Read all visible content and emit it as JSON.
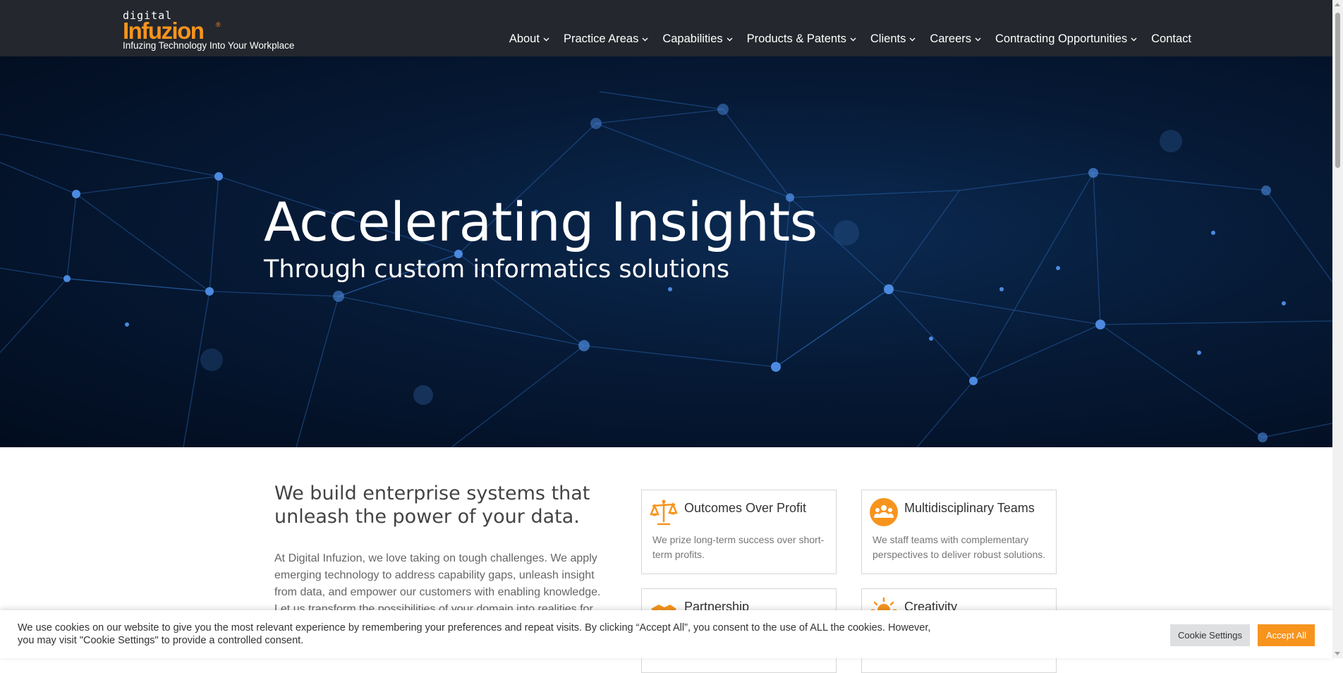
{
  "header": {
    "logo": {
      "small": "digital",
      "brand": "Infuzion",
      "reg": "®",
      "tagline": "Infuzing Technology Into Your Workplace"
    },
    "nav": [
      {
        "label": "About",
        "has_dropdown": true
      },
      {
        "label": "Practice Areas",
        "has_dropdown": true
      },
      {
        "label": "Capabilities",
        "has_dropdown": true
      },
      {
        "label": "Products & Patents",
        "has_dropdown": true
      },
      {
        "label": "Clients",
        "has_dropdown": true
      },
      {
        "label": "Careers",
        "has_dropdown": true
      },
      {
        "label": "Contracting Opportunities",
        "has_dropdown": true
      },
      {
        "label": "Contact",
        "has_dropdown": false
      }
    ]
  },
  "hero": {
    "title": "Accelerating Insights",
    "subtitle": "Through custom informatics solutions"
  },
  "intro": {
    "heading": "We build enterprise systems that unleash the power of your data.",
    "text": "At Digital Infuzion, we love taking on tough challenges. We apply emerging technology to address capability gaps, unleash insight from data, and empower our customers with enabling knowledge. Let us transform the possibilities of your domain into realities for"
  },
  "values": [
    {
      "title": "Outcomes Over Profit",
      "desc": "We prize long-term success over short-term profits.",
      "icon": "scale-icon"
    },
    {
      "title": "Multidisciplinary Teams",
      "desc": "We staff teams with complementary perspectives to deliver robust solutions.",
      "icon": "team-icon"
    },
    {
      "title": "Partnership",
      "desc": "",
      "icon": "handshake-icon"
    },
    {
      "title": "Creativity",
      "desc": "",
      "icon": "lightbulb-icon"
    }
  ],
  "cookie": {
    "text": "We use cookies on our website to give you the most relevant experience by remembering your preferences and repeat visits. By clicking “Accept All”, you consent to the use of ALL the cookies. However, you may visit \"Cookie Settings\" to provide a controlled consent.",
    "settings_label": "Cookie Settings",
    "accept_label": "Accept All"
  },
  "colors": {
    "accent": "#f7941d",
    "header_bg": "#24272d",
    "hero_bg": "#061a36"
  }
}
